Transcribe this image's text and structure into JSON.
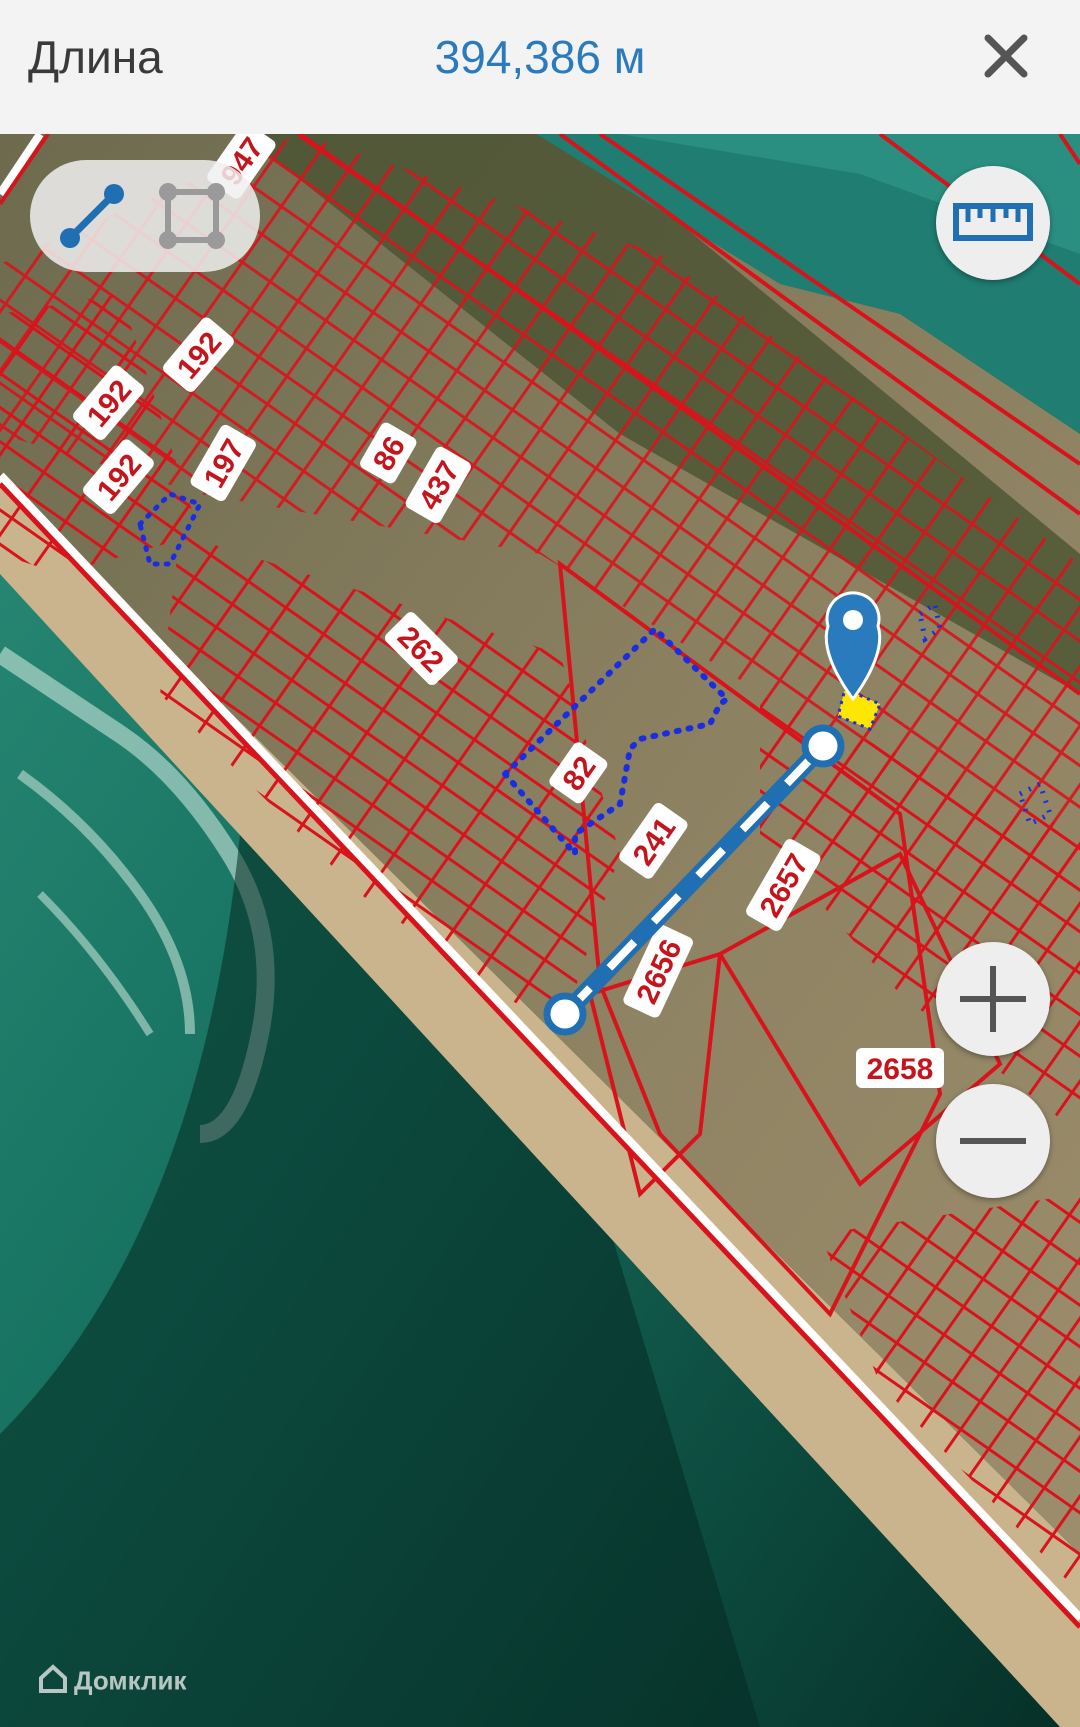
{
  "header": {
    "title": "Длина",
    "measurement": "394,386 м",
    "close_icon": "close-icon"
  },
  "toolbar": {
    "line_tool_icon": "line-measure-icon",
    "area_tool_icon": "area-measure-icon"
  },
  "controls": {
    "ruler_icon": "ruler-icon",
    "zoom_in_icon": "plus-icon",
    "zoom_out_icon": "minus-icon"
  },
  "map": {
    "parcel_labels": [
      "947",
      "192",
      "192",
      "197",
      "86",
      "437",
      "192",
      "262",
      "82",
      "241",
      "2657",
      "2656",
      "2658"
    ],
    "colors": {
      "parcel_outline": "#d9131b",
      "measure_line": "#1f6fb2",
      "selection_dots": "#1a2ee0",
      "highlight": "#ffe600"
    }
  },
  "watermark": {
    "text": "Домклик",
    "icon": "domclick-logo-icon"
  }
}
